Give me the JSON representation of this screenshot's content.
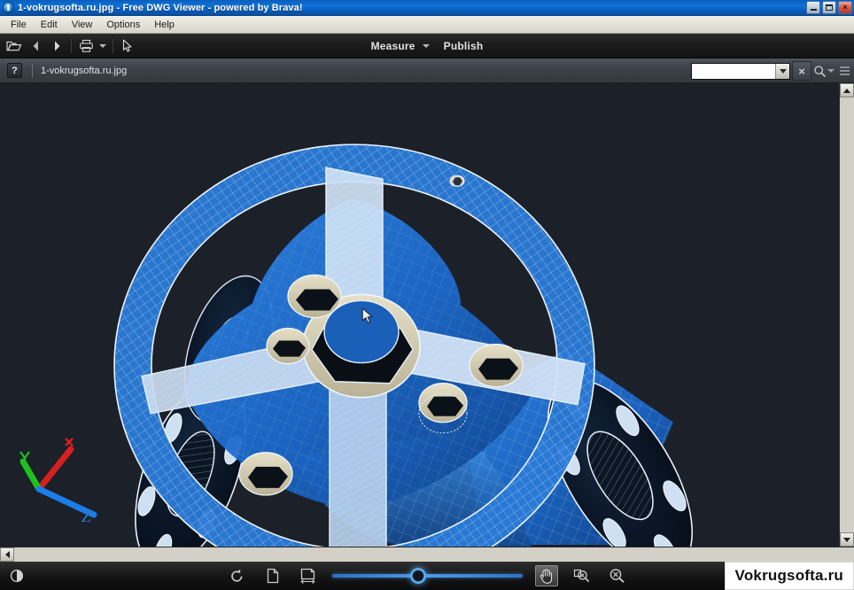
{
  "window": {
    "title": "1-vokrugsofta.ru.jpg - Free DWG Viewer - powered by Brava!",
    "app_icon": "brava-app-icon",
    "controls": {
      "minimize": "minimize-button",
      "maximize": "maximize-button",
      "close": "close-button",
      "close_glyph": "×"
    }
  },
  "menubar": {
    "items": [
      {
        "label": "File"
      },
      {
        "label": "Edit"
      },
      {
        "label": "View"
      },
      {
        "label": "Options"
      },
      {
        "label": "Help"
      }
    ]
  },
  "toolbar": {
    "open_icon": "open-folder-icon",
    "back_icon": "back-arrow-icon",
    "forward_icon": "forward-arrow-icon",
    "print_icon": "print-icon",
    "print_dropdown_icon": "chevron-down-icon",
    "select_icon": "select-pointer-icon",
    "measure_label": "Measure",
    "measure_dropdown_icon": "chevron-down-icon",
    "publish_label": "Publish"
  },
  "docbar": {
    "help_label": "?",
    "file_name": "1-vokrugsofta.ru.jpg",
    "search_value": "",
    "search_placeholder": "",
    "search_dropdown_icon": "chevron-down-icon",
    "clear_label": "×",
    "find_icon": "magnifier-icon",
    "find_dropdown_icon": "chevron-down-icon",
    "menu_icon": "hamburger-menu-icon"
  },
  "canvas": {
    "background_color": "#1b2029",
    "model_blue": "#1f6fd0",
    "model_blue_dark": "#0d3a74",
    "wireframe_color": "#dfe8f2",
    "metal_color": "#cfc8ab",
    "dark_face": "#0a1420",
    "cursor_icon": "mouse-pointer-cursor",
    "axis_indicator": {
      "name": "3d-axis-indicator",
      "axes": [
        {
          "label": "X",
          "color": "#e02020"
        },
        {
          "label": "Y",
          "color": "#18c018"
        },
        {
          "label": "Z",
          "color": "#1878e6"
        }
      ]
    }
  },
  "scrollbars": {
    "vertical": {
      "up_icon": "scroll-up-arrow",
      "down_icon": "scroll-down-arrow"
    },
    "horizontal": {
      "left_icon": "scroll-left-arrow"
    }
  },
  "bottombar": {
    "brightness_icon": "brightness-contrast-icon",
    "rotate_icon": "rotate-left-icon",
    "fit_page_icon": "fit-page-icon",
    "fit_width_icon": "fit-width-icon",
    "zoom_slider": {
      "name": "zoom-slider",
      "value": 41
    },
    "pan_icon": "hand-pan-tool-icon",
    "pan_active": true,
    "zoom_window_icon": "zoom-to-window-icon",
    "zoom_out_icon": "zoom-out-icon"
  },
  "watermark": {
    "text": "Vokrugsofta.ru"
  }
}
